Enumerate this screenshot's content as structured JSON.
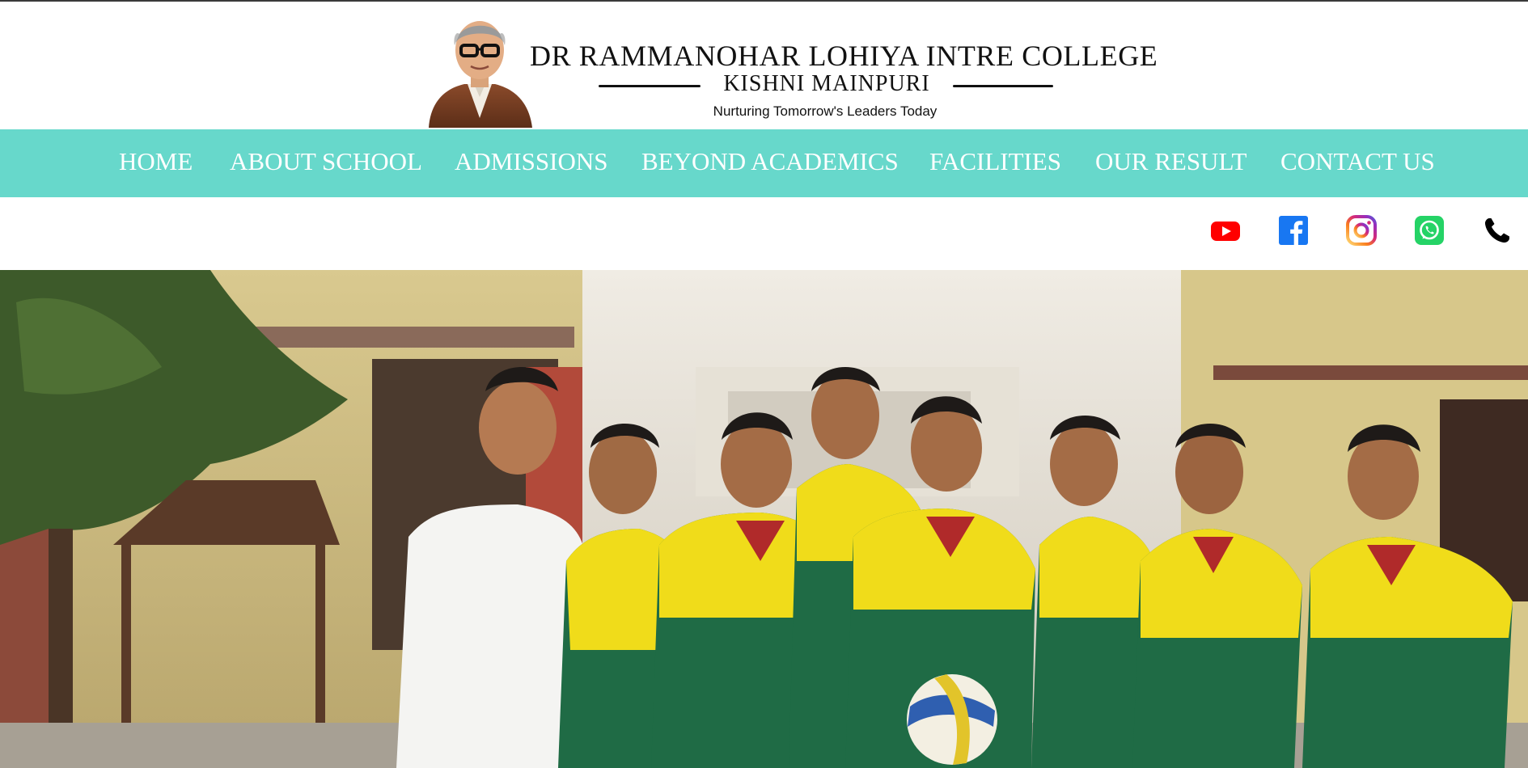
{
  "header": {
    "college_name": "DR RAMMANOHAR LOHIYA INTRE COLLEGE",
    "college_location": "KISHNI MAINPURI",
    "tagline": "Nurturing Tomorrow's Leaders Today"
  },
  "nav": {
    "items": [
      {
        "label": "HOME"
      },
      {
        "label": "ABOUT SCHOOL"
      },
      {
        "label": "ADMISSIONS"
      },
      {
        "label": "BEYOND ACADEMICS"
      },
      {
        "label": "FACILITIES"
      },
      {
        "label": "OUR RESULT"
      },
      {
        "label": "CONTACT US"
      }
    ]
  },
  "social": {
    "icons": [
      "youtube-icon",
      "facebook-icon",
      "instagram-icon",
      "whatsapp-icon",
      "phone-icon"
    ]
  },
  "hero": {
    "image": "students-volleyball-team-photo"
  },
  "colors": {
    "nav_bg": "#67d8cb",
    "nav_text": "#ffffff",
    "youtube": "#ff0000",
    "facebook": "#1877f2",
    "whatsapp": "#25d366"
  }
}
